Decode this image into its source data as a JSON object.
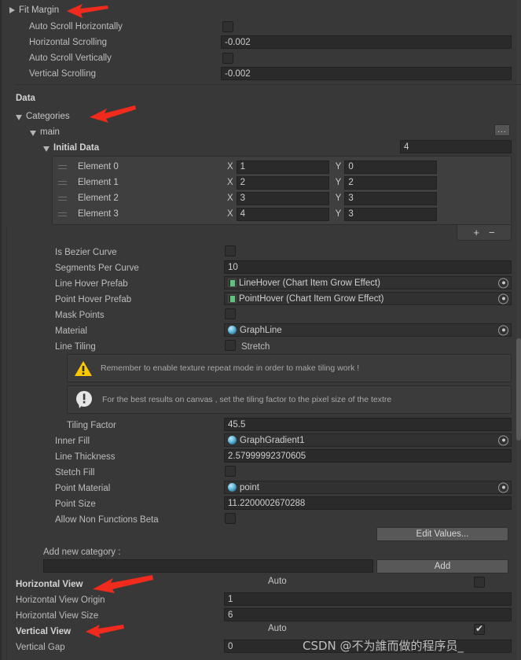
{
  "top": {
    "fit_margin": "Fit Margin",
    "rows": [
      {
        "label": "Auto Scroll Horizontally",
        "type": "checkbox",
        "value": false
      },
      {
        "label": "Horizontal Scrolling",
        "type": "text",
        "value": "-0.002"
      },
      {
        "label": "Auto Scroll Vertically",
        "type": "checkbox",
        "value": false
      },
      {
        "label": "Vertical Scrolling",
        "type": "text",
        "value": "-0.002"
      }
    ]
  },
  "data_section": {
    "title": "Data",
    "categories_label": "Categories",
    "main_label": "main",
    "dots_button": "...",
    "initial_data_label": "Initial Data",
    "array_size": "4",
    "elements": [
      {
        "name": "Element 0",
        "x_label": "X",
        "x": "1",
        "y_label": "Y",
        "y": "0"
      },
      {
        "name": "Element 1",
        "x_label": "X",
        "x": "2",
        "y_label": "Y",
        "y": "2"
      },
      {
        "name": "Element 2",
        "x_label": "X",
        "x": "3",
        "y_label": "Y",
        "y": "3"
      },
      {
        "name": "Element 3",
        "x_label": "X",
        "x": "4",
        "y_label": "Y",
        "y": "3"
      }
    ],
    "add_element_button": "+",
    "remove_element_button": "−"
  },
  "properties": {
    "is_bezier_curve": {
      "label": "Is Bezier Curve",
      "value": false
    },
    "segments_per_curve": {
      "label": "Segments Per Curve",
      "value": "10"
    },
    "line_hover_prefab": {
      "label": "Line Hover Prefab",
      "value": "LineHover (Chart Item Grow Effect)"
    },
    "point_hover_prefab": {
      "label": "Point Hover Prefab",
      "value": "PointHover (Chart Item Grow Effect)"
    },
    "mask_points": {
      "label": "Mask Points",
      "value": false
    },
    "material": {
      "label": "Material",
      "value": "GraphLine"
    },
    "line_tiling": {
      "label": "Line Tiling",
      "value": false,
      "option": "Stretch"
    },
    "warning_text": "Remember to enable texture repeat mode in order to make tiling work !",
    "info_text": "For the best results on canvas , set the tiling factor to the pixel size of the textre",
    "tiling_factor": {
      "label": "Tiling Factor",
      "value": "45.5"
    },
    "inner_fill": {
      "label": "Inner Fill",
      "value": "GraphGradient1"
    },
    "line_thickness": {
      "label": "Line Thickness",
      "value": "2.57999992370605"
    },
    "stetch_fill": {
      "label": "Stetch Fill",
      "value": false
    },
    "point_material": {
      "label": "Point Material",
      "value": "point"
    },
    "point_size": {
      "label": "Point Size",
      "value": "11.2200002670288"
    },
    "allow_non_functions_beta": {
      "label": "Allow Non Functions Beta",
      "value": false
    },
    "edit_values_button": "Edit Values..."
  },
  "add_category": {
    "label": "Add new category :",
    "input_value": "",
    "button": "Add"
  },
  "views": {
    "horizontal_view": {
      "label": "Horizontal View",
      "auto_label": "Auto",
      "auto": false
    },
    "horizontal_view_origin": {
      "label": "Horizontal View Origin",
      "value": "1"
    },
    "horizontal_view_size": {
      "label": "Horizontal View Size",
      "value": "6"
    },
    "vertical_view": {
      "label": "Vertical View",
      "auto_label": "Auto",
      "auto": true
    },
    "vertical_gap": {
      "label": "Vertical Gap",
      "value": "0"
    }
  },
  "watermark": "CSDN @不为誰而做的程序员_",
  "colors": {
    "background": "#383838",
    "field": "#2a2a2a",
    "accent_warning": "#ffc800",
    "annotation_arrow": "#f02b1d"
  }
}
